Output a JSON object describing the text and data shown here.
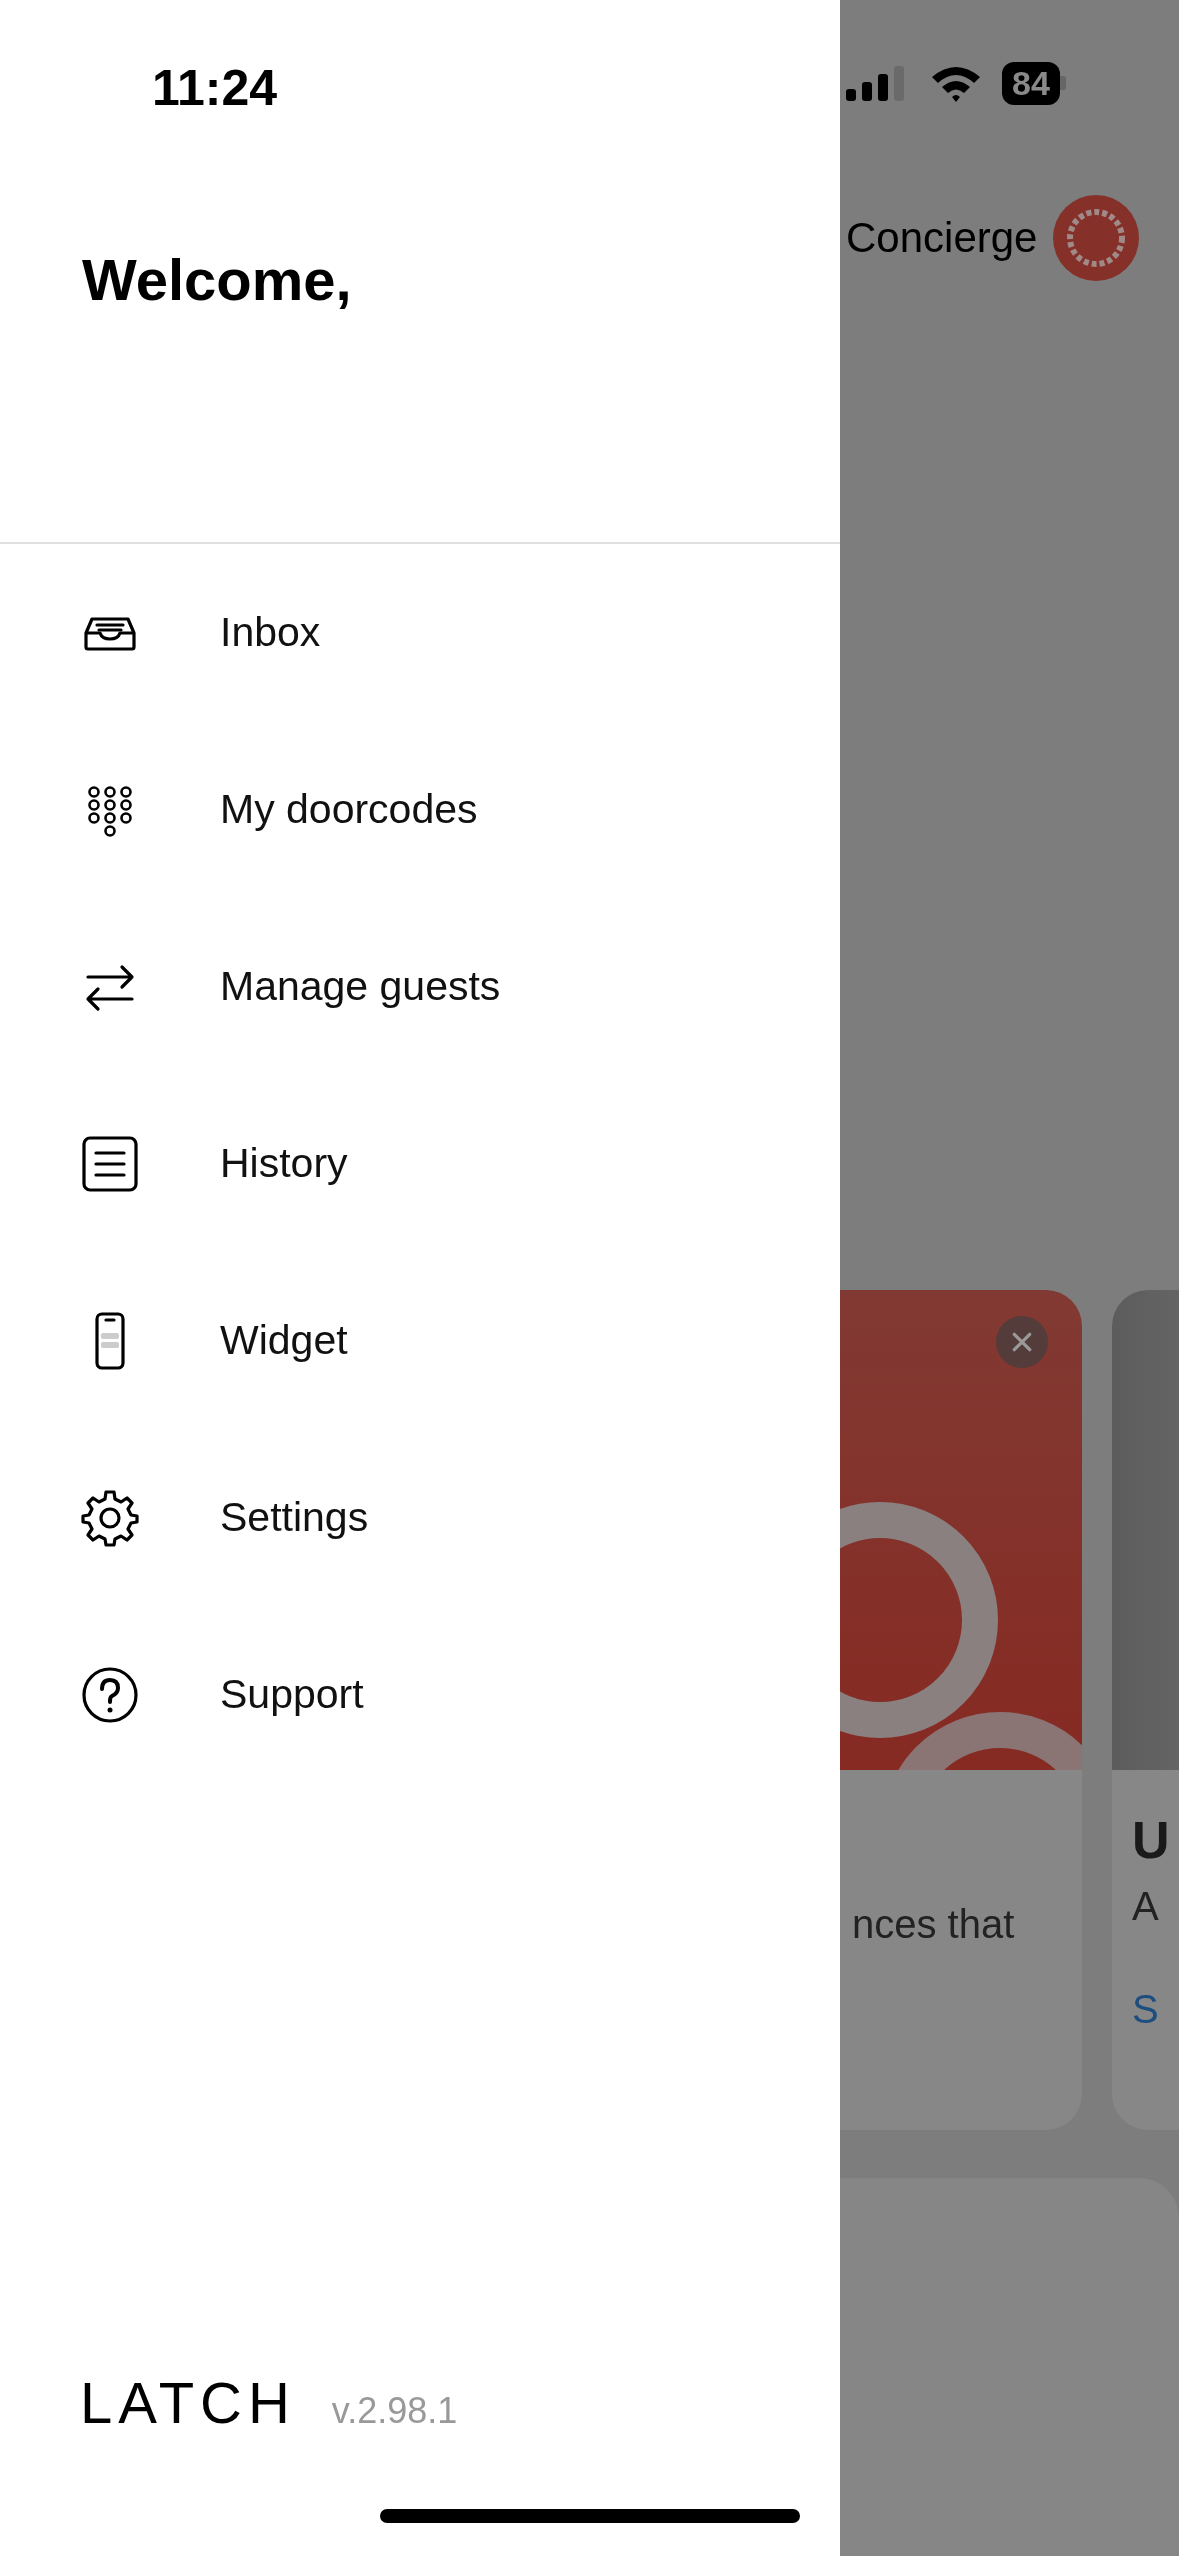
{
  "status_bar": {
    "time": "11:24",
    "battery": "84"
  },
  "drawer": {
    "greeting": "Welcome,",
    "menu": [
      {
        "label": "Inbox"
      },
      {
        "label": "My doorcodes"
      },
      {
        "label": "Manage guests"
      },
      {
        "label": "History"
      },
      {
        "label": "Widget"
      },
      {
        "label": "Settings"
      },
      {
        "label": "Support"
      }
    ],
    "logo": "LATCH",
    "version": "v.2.98.1"
  },
  "background": {
    "header_title": "Concierge",
    "cards": [
      {
        "kind": "promo",
        "text": "nces that"
      },
      {
        "kind": "photo",
        "title": "U",
        "text": "A",
        "link": "S"
      }
    ]
  }
}
